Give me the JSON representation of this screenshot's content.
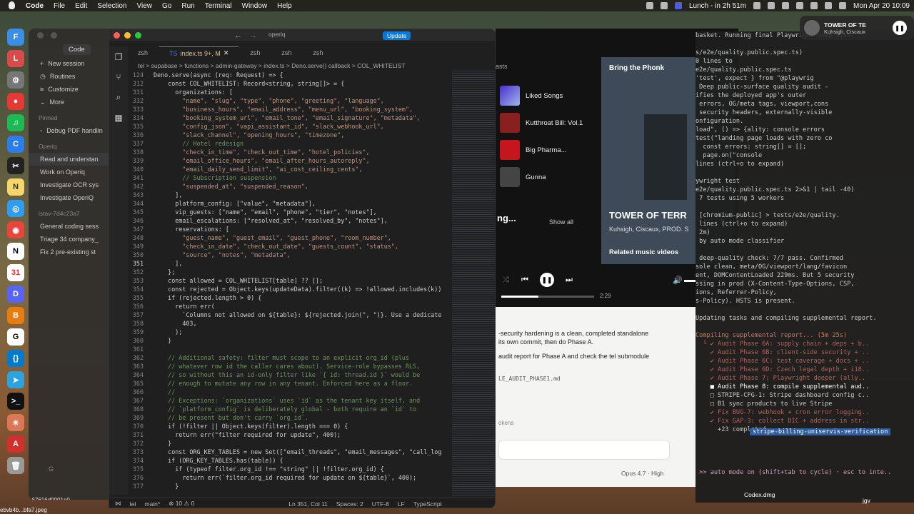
{
  "menubar": {
    "apple": "",
    "app": "Code",
    "items": [
      "File",
      "Edit",
      "Selection",
      "View",
      "Go",
      "Run",
      "Terminal",
      "Window",
      "Help"
    ],
    "calendar": "Lunch - in 2h 51m",
    "clock": "Mon Apr 20  10:09"
  },
  "sidebar": {
    "code_label": "Code",
    "items": [
      "New session",
      "Routines",
      "Customize",
      "More"
    ],
    "pinned_head": "Pinned",
    "pinned": [
      "Debug PDF handlin"
    ],
    "group1": "Operiq",
    "group1_items": [
      "Read and understan",
      "Work on Operiq",
      "Investigate OCR sys",
      "Investigate OperiQ"
    ],
    "group2": "istav-7d4c23a7",
    "group2_items": [
      "General coding sess",
      "Triage 34 company_",
      "Fix 2 pre-existing st"
    ],
    "bottom": "G",
    "file1": "b67616d0001e0",
    "file2": "ebvb4b...bfa7.jpeg"
  },
  "editor": {
    "search": "operiq",
    "update_btn": "Update",
    "tabs": [
      "zsh",
      "index.ts 9+, M",
      "zsh",
      "zsh",
      "zsh"
    ],
    "crumbs": "tel > supabase > functions > admin-gateway > index.ts > Deno.serve() callback > COL_WHITELIST",
    "lines": [
      [
        "124",
        "Deno.serve(async (req: Request) => {"
      ],
      [
        "312",
        "    const COL_WHITELIST: Record<string, string[]> = {"
      ],
      [
        "331",
        "      organizations: ["
      ],
      [
        "332",
        "        \"name\", \"slug\", \"type\", \"phone\", \"greeting\", \"language\","
      ],
      [
        "333",
        "        \"business_hours\", \"email_address\", \"menu_url\", \"booking_system\","
      ],
      [
        "334",
        "        \"booking_system_url\", \"email_tone\", \"email_signature\", \"metadata\","
      ],
      [
        "335",
        "        \"config_json\", \"vapi_assistant_id\", \"slack_webhook_url\","
      ],
      [
        "336",
        "        \"slack_channel\", \"opening_hours\", \"timezone\","
      ],
      [
        "337",
        "        // Hotel redesign"
      ],
      [
        "338",
        "        \"check_in_time\", \"check_out_time\", \"hotel_policies\","
      ],
      [
        "339",
        "        \"email_office_hours\", \"email_after_hours_autoreply\","
      ],
      [
        "340",
        "        \"email_daily_send_limit\", \"ai_cost_ceiling_cents\","
      ],
      [
        "341",
        "        // Subscription suspension"
      ],
      [
        "342",
        "        \"suspended_at\", \"suspended_reason\","
      ],
      [
        "343",
        "      ],"
      ],
      [
        "344",
        "      platform_config: [\"value\", \"metadata\"],"
      ],
      [
        "345",
        "      vip_guests: [\"name\", \"email\", \"phone\", \"tier\", \"notes\"],"
      ],
      [
        "346",
        "      email_escalations: [\"resolved_at\", \"resolved_by\", \"notes\"],"
      ],
      [
        "347",
        "      reservations: ["
      ],
      [
        "348",
        "        \"guest_name\", \"guest_email\", \"guest_phone\", \"room_number\","
      ],
      [
        "349",
        "        \"check_in_date\", \"check_out_date\", \"guests_count\", \"status\","
      ],
      [
        "350",
        "        \"source\", \"notes\", \"metadata\","
      ],
      [
        "351",
        "      ],"
      ],
      [
        "352",
        "    };"
      ],
      [
        "353",
        "    const allowed = COL_WHITELIST[table] ?? [];"
      ],
      [
        "354",
        "    const rejected = Object.keys(updateData).filter((k) => !allowed.includes(k))"
      ],
      [
        "355",
        "    if (rejected.length > 0) {"
      ],
      [
        "356",
        "      return err("
      ],
      [
        "357",
        "        `Columns not allowed on ${table}: ${rejected.join(\", \")}. Use a dedicate"
      ],
      [
        "358",
        "        403,"
      ],
      [
        "359",
        "      );"
      ],
      [
        "360",
        "    }"
      ],
      [
        "361",
        ""
      ],
      [
        "362",
        "    // Additional safety: filter must scope to an explicit org_id (plus"
      ],
      [
        "363",
        "    // whatever row id the caller cares about). Service-role bypasses RLS,"
      ],
      [
        "364",
        "    // so without this an id-only filter like `{ id: thread.id }` would be"
      ],
      [
        "365",
        "    // enough to mutate any row in any tenant. Enforced here as a floor."
      ],
      [
        "366",
        "    //"
      ],
      [
        "367",
        "    // Exceptions: `organizations` uses `id` as the tenant key itself, and"
      ],
      [
        "368",
        "    // `platform_config` is deliberately global - both require an `id` to"
      ],
      [
        "369",
        "    // be present but don't carry `org_id`."
      ],
      [
        "370",
        "    if (!filter || Object.keys(filter).length === 0) {"
      ],
      [
        "371",
        "      return err(\"filter required for update\", 400);"
      ],
      [
        "372",
        "    }"
      ],
      [
        "373",
        "    const ORG_KEY_TABLES = new Set([\"email_threads\", \"email_messages\", \"call_log"
      ],
      [
        "374",
        "    if (ORG_KEY_TABLES.has(table)) {"
      ],
      [
        "375",
        "      if (typeof filter.org_id !== \"string\" || !filter.org_id) {"
      ],
      [
        "376",
        "        return err(`filter.org_id required for update on ${table}`, 400);"
      ],
      [
        "377",
        "      }"
      ]
    ],
    "status": {
      "branch": "tel",
      "main": "main*",
      "errors": "10",
      "warnings": "0",
      "position": "Ln 351, Col 11",
      "spaces": "Spaces: 2",
      "encoding": "UTF-8",
      "eol": "LF",
      "lang": "TypeScript"
    }
  },
  "spotify": {
    "tab": "asts",
    "library": [
      "Liked Songs",
      "Kutthroat Bill: Vol.1",
      "Big Pharma...",
      "Gunna"
    ],
    "section": "ng...",
    "show_all": "Show all",
    "panel_title": "Bring the Phonk",
    "track": "TOWER OF TERR",
    "artists": "Kuhsigh, Ciscaux, PROD. S",
    "related": "Related music videos",
    "time": "2:29"
  },
  "nowplaying": {
    "title": "TOWER OF TE",
    "artist": "Kuhsigh, Ciscaux"
  },
  "chat": {
    "p1": "-security hardening is a clean, completed standalone",
    "p2": "its own commit, then do Phase A.",
    "p3": "audit report for Phase A and check the tel submodule",
    "file": "LE_AUDIT_PHASE1.md",
    "tokens": "okens",
    "model": "Opus 4.7 · High"
  },
  "terminal": {
    "lines": [
      "basket. Running final Playwright deep-dive.",
      "",
      "s/e2e/quality.public.spec.ts)",
      "0 lines to",
      "e2e/quality.public.spec.ts",
      "'test', expect } from \"@playwrig",
      " Deep public-surface quality audit -",
      "ifies the deployed app's outer",
      " errors, OG/meta tags, viewport,cons",
      " security headers, externally-visible",
      "onfiguration.",
      "load\", () => {ality: console errors",
      "test(\"landing page loads with zero co",
      "  const errors: string[] = [];",
      "  page.on(\"console",
      "lines (ctrl+o to expand)",
      "",
      "ywright test",
      "e2e/quality.public.spec.ts 2>&1 | tail -40)",
      " 7 tests using 5 workers",
      "",
      " [chromium-public] > tests/e2e/quality.",
      " lines (ctrl+o to expand)",
      " 2m)",
      " by auto mode classifier",
      "",
      " deep-quality check: 7/7 pass. Confirmed",
      "sole clean, meta/OG/viewport/lang/favicon",
      "ent, DOMContentLoaded 229ms. But 5 security",
      "ssing in prod (X-Content-Type-Options, CSP,",
      "ions, Referrer-Policy,",
      "s-Policy). HSTS is present.",
      "",
      "Updating tasks and compiling supplemental report.",
      "",
      "Compiling supplemental report... (5m 25s)",
      "  └ ✔ Audit Phase 6A: supply chain + deps + b..",
      "    ✔ Audit Phase 6B: client-side security + ..",
      "    ✔ Audit Phase 6C: test coverage + docs + ..",
      "    ✔ Audit Phase 6D: Czech legal depth + i18..",
      "    ✔ Audit Phase 7: Playwright deeper (ally..",
      "    ■ Audit Phase 8: compile supplemental aud..",
      "    □ STRIPE-CFG-1: Stripe dashboard config c..",
      "    □ B1 sync products to live Stripe",
      "    ✔ Fix BUG-7: webhook + cron error logging..",
      "    ✔ Fix GAP-3: collect DIC + address in str..",
      "      +23 completed",
      "",
      "",
      "",
      "",
      " >> auto mode on (shift+tab to cycle) · esc to inte.."
    ],
    "tag": "stripe-billing-uniservis-verification",
    "desktop": "Codex.dmg",
    "desktop2": "jgv"
  }
}
